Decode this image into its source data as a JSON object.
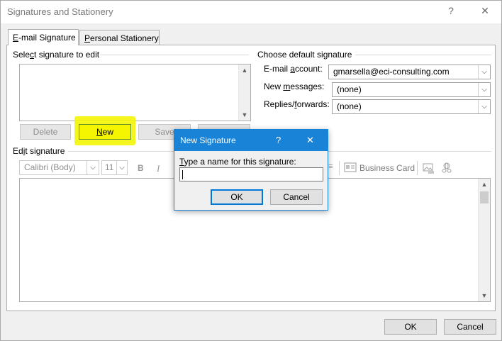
{
  "window": {
    "title": "Signatures and Stationery",
    "help_glyph": "?",
    "close_glyph": "✕"
  },
  "tabs": [
    {
      "pre": "",
      "key": "E",
      "post": "-mail Signature",
      "active": true
    },
    {
      "pre": "",
      "key": "P",
      "post": "ersonal Stationery",
      "active": false
    }
  ],
  "select_section": {
    "label_pre": "Sele",
    "label_key": "c",
    "label_post": "t signature to edit"
  },
  "buttons": {
    "delete": "Delete",
    "new_key": "N",
    "new_post": "ew",
    "save": "Save",
    "ok": "OK",
    "cancel": "Cancel"
  },
  "default_signature": {
    "title": "Choose default signature",
    "email_account_pre": "E-mail ",
    "email_account_key": "a",
    "email_account_post": "ccount:",
    "email_account_value": "gmarsella@eci-consulting.com",
    "new_messages_pre": "New ",
    "new_messages_key": "m",
    "new_messages_post": "essages:",
    "new_messages_value": "(none)",
    "replies_pre": "Replies/",
    "replies_key": "f",
    "replies_post": "orwards:",
    "replies_value": "(none)"
  },
  "edit_section": {
    "label_pre": "Ed",
    "label_key": "i",
    "label_post": "t signature",
    "font_name": "Calibri (Body)",
    "font_size": "11",
    "bold_glyph": "B",
    "italic_glyph": "I",
    "business_card": "Business Card"
  },
  "popup": {
    "title": "New Signature",
    "help_glyph": "?",
    "close_glyph": "✕",
    "prompt_key": "T",
    "prompt_post": "ype a name for this signature:",
    "input_value": "",
    "ok": "OK",
    "cancel": "Cancel"
  },
  "colors": {
    "accent": "#1883d7",
    "highlight": "#f5f500"
  }
}
